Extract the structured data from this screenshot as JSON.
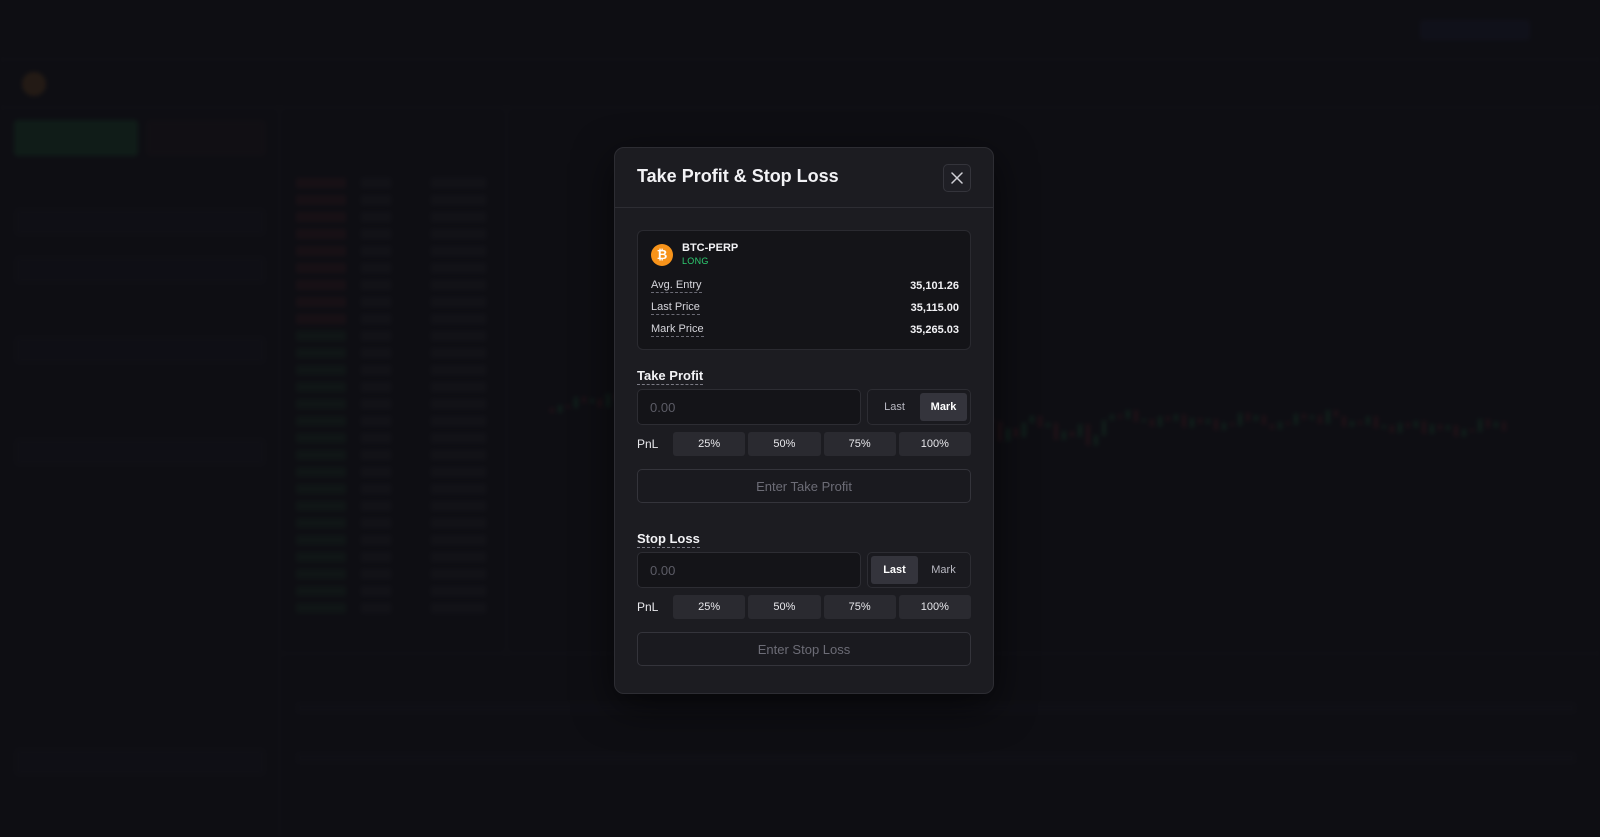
{
  "modal": {
    "title": "Take Profit & Stop Loss",
    "close_icon": "close-icon"
  },
  "position": {
    "coin_icon": "bitcoin-icon",
    "coin_glyph": "₿",
    "symbol": "BTC-PERP",
    "side": "LONG",
    "stats": [
      {
        "label": "Avg. Entry",
        "value": "35,101.26"
      },
      {
        "label": "Last Price",
        "value": "35,115.00"
      },
      {
        "label": "Mark Price",
        "value": "35,265.03"
      }
    ]
  },
  "take_profit": {
    "label": "Take Profit",
    "placeholder": "0.00",
    "value": "",
    "toggle_options": [
      "Last",
      "Mark"
    ],
    "selected": "Mark",
    "pnl_label": "PnL",
    "pnl_options": [
      "25%",
      "50%",
      "75%",
      "100%"
    ],
    "submit_label": "Enter Take Profit"
  },
  "stop_loss": {
    "label": "Stop Loss",
    "placeholder": "0.00",
    "value": "",
    "toggle_options": [
      "Last",
      "Mark"
    ],
    "selected": "Last",
    "pnl_label": "PnL",
    "pnl_options": [
      "25%",
      "50%",
      "75%",
      "100%"
    ],
    "submit_label": "Enter Stop Loss"
  },
  "colors": {
    "long": "#2ecc71",
    "bitcoin": "#f7931a",
    "active_toggle": "#34343c"
  }
}
